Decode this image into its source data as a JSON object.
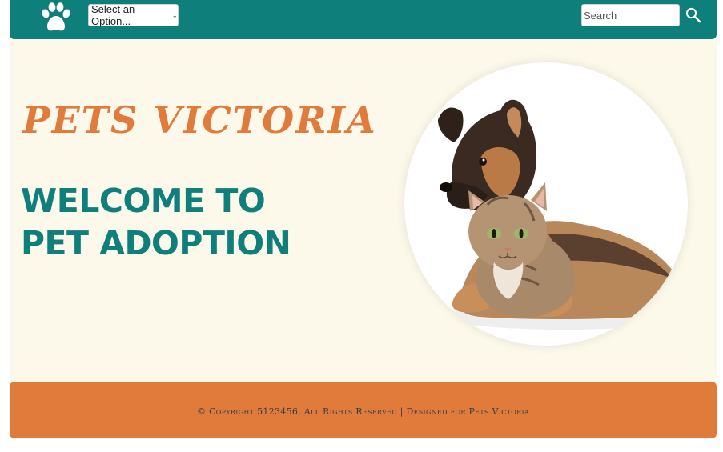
{
  "nav": {
    "logo_icon": "paw-icon",
    "select_value": "Select an Option...",
    "search_placeholder": "Search",
    "search_icon": "magnifier-icon"
  },
  "hero": {
    "brand": "Pets Victoria",
    "welcome": "Welcome to Pet Adoption"
  },
  "footer": {
    "text": "© Copyright 5123456. All Rights Reserved | Designed for Pets Victoria"
  },
  "colors": {
    "teal": "#0f7f7c",
    "orange": "#e07b3b",
    "cream": "#fcf8ea"
  }
}
